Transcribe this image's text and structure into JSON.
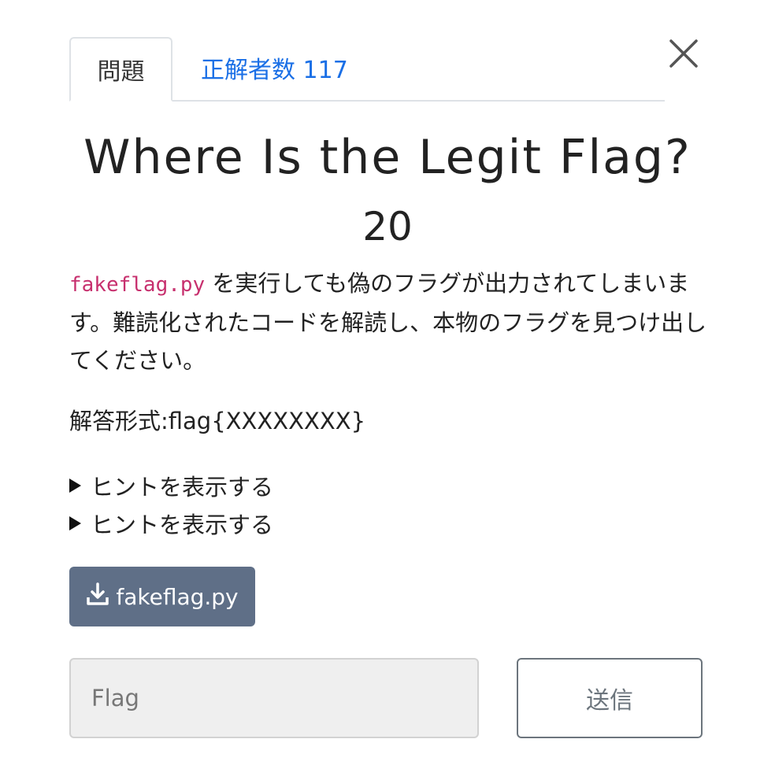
{
  "tabs": [
    {
      "label": "問題"
    },
    {
      "label": "正解者数 117"
    }
  ],
  "challenge": {
    "title": "Where Is the Legit Flag?",
    "points": "20",
    "desc_code": "fakeflag.py",
    "desc_text": "を実行しても偽のフラグが出力されてしまいます。難読化されたコードを解読し、本物のフラグを見つけ出してください。",
    "format": "解答形式:flag{XXXXXXXX}",
    "hints": [
      {
        "label": "ヒントを表示する"
      },
      {
        "label": "ヒントを表示する"
      }
    ],
    "download_label": "fakeflag.py"
  },
  "form": {
    "placeholder": "Flag",
    "submit_label": "送信"
  },
  "icons": {
    "close": "close-icon",
    "download": "download-icon",
    "hint": "triangle-right-icon"
  },
  "colors": {
    "link": "#1a6fe6",
    "code": "#c7306e",
    "download_button": "#5f6f87"
  }
}
